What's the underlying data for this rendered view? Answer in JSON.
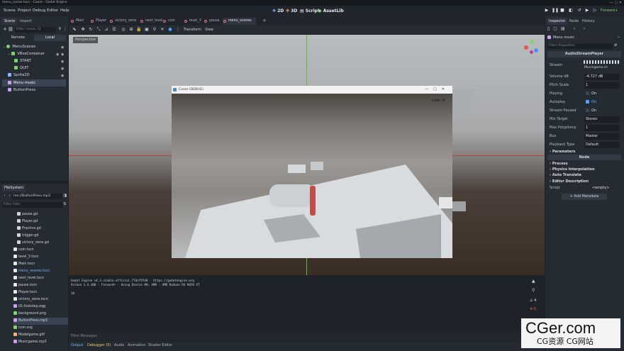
{
  "window": {
    "title": "menu_scene.tscn - Coore - Godot Engine"
  },
  "menu": [
    "Scene",
    "Project",
    "Debug",
    "Editor",
    "Help"
  ],
  "modes": {
    "m2d": "2D",
    "m3d": "3D",
    "script": "Script",
    "assetlib": "AssetLib"
  },
  "renderer": "Forward+",
  "scene_dock": {
    "tabs": [
      "Scene",
      "Import"
    ],
    "filter_placeholder": "Filter: name, t3",
    "remote": "Remote",
    "local": "Local",
    "nodes": [
      "MenuScenes",
      "VBoxContainer",
      "START",
      "QUIT",
      "Sprite2D",
      "Menu music",
      "ButtonPress"
    ]
  },
  "filesystem": {
    "tab": "FileSystem",
    "path": "res://ButtonPress.mp3",
    "filter_placeholder": "Filter Files",
    "files": [
      "pause.gd",
      "Player.gd",
      "Practice.gd",
      "trigger.gd",
      "victory_zone.gd",
      "coin.tscn",
      "level_3.tscn",
      "Main.tscn",
      "menu_scenes.tscn",
      "next_level.tscn",
      "pause.tscn",
      "Player.tscn",
      "victory_zone.tscn",
      "01-footstep.ogg",
      "background.png",
      "ButtonPress.mp3",
      "icon.svg",
      "Modelgame.glif",
      "Musicgame.mp3"
    ]
  },
  "scene_tabs": [
    "Main",
    "Player",
    "victory_zone",
    "next_level",
    "coin",
    "level_3",
    "pause",
    "menu_scenes"
  ],
  "toolbar": {
    "transform": "Transform",
    "view": "View"
  },
  "viewport": {
    "perspective": "Perspective"
  },
  "game_window": {
    "title": "Coore (DEBUG)",
    "hud": "coin :0"
  },
  "output": {
    "lines": [
      "Godot Engine v4.3.stable.official.77dcf97d8 - https://godotengine.org",
      "Vulkan 1.4.308 - Forward+ - Using Device #0: AMD - AMD Radeon RX 9070 XT",
      "",
      "10"
    ],
    "filter_placeholder": "Filter Messages",
    "count_warn": "4",
    "count_err": "0",
    "tabs": [
      "Output",
      "Debugger (5)",
      "Audio",
      "Animation",
      "Shader Editor"
    ]
  },
  "inspector": {
    "tabs": [
      "Inspector",
      "Node",
      "History"
    ],
    "node": "Menu music",
    "filter_placeholder": "Filter Properties",
    "class": "AudioStreamPlayer",
    "props": [
      {
        "k": "Stream",
        "v": "Musicgame.m"
      },
      {
        "k": "Volume dB",
        "v": "-4.727 dB"
      },
      {
        "k": "Pitch Scale",
        "v": "1"
      },
      {
        "k": "Playing",
        "v": "On"
      },
      {
        "k": "Autoplay",
        "v": "On"
      },
      {
        "k": "Stream Paused",
        "v": "On"
      },
      {
        "k": "Mix Target",
        "v": "Stereo"
      },
      {
        "k": "Max Polyphony",
        "v": "1"
      },
      {
        "k": "Bus",
        "v": "Master"
      },
      {
        "k": "Playback Type",
        "v": "Default"
      }
    ],
    "parameters": "Parameters",
    "node_section": "Node",
    "process": "Process",
    "physics": "Physics Interpolation",
    "auto_translate": "Auto Translate",
    "editor_desc": "Editor Description",
    "script": "Script",
    "script_v": "<empty>",
    "add_metadata": "Add Metadata"
  },
  "watermark": {
    "big": "CGer.com",
    "small": "CG资源 CG网站"
  }
}
